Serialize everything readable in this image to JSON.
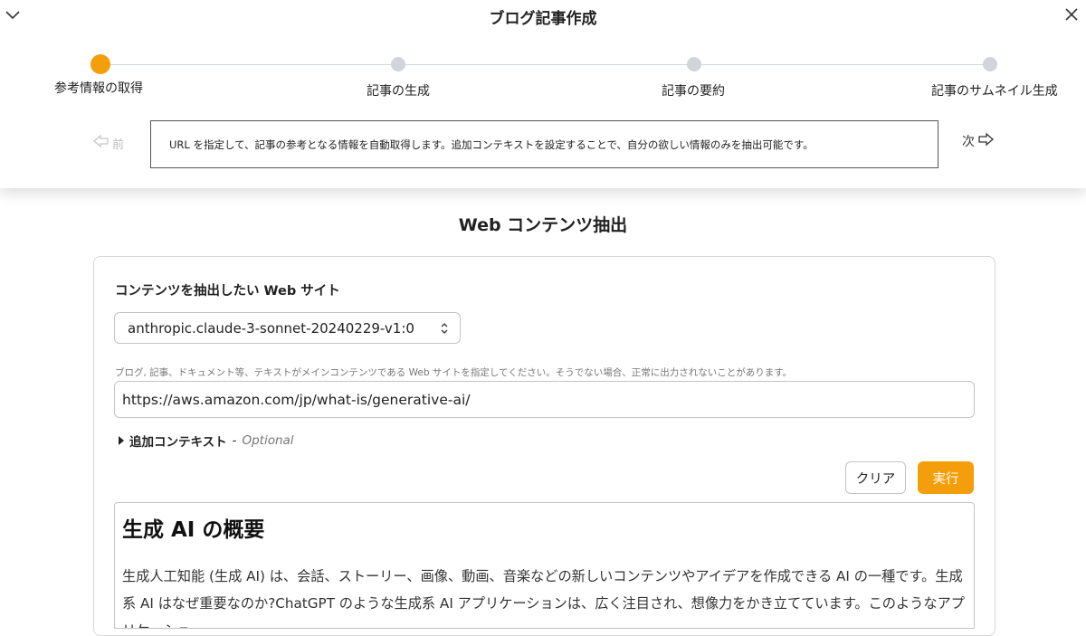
{
  "header": {
    "title": "ブログ記事作成",
    "collapse_icon": "chevron-down-icon",
    "close_icon": "close-icon"
  },
  "stepper": {
    "active_index": 0,
    "active_color": "#f59e0b",
    "inactive_color": "#d1d5db",
    "steps": [
      {
        "label": "参考情報の取得"
      },
      {
        "label": "記事の生成"
      },
      {
        "label": "記事の要約"
      },
      {
        "label": "記事のサムネイル生成"
      }
    ],
    "prev_label": "前",
    "next_label": "次",
    "description": "URL を指定して、記事の参考となる情報を自動取得します。追加コンテキストを設定することで、自分の欲しい情報のみを抽出可能です。"
  },
  "main": {
    "section_title": "Web コンテンツ抽出",
    "field_label": "コンテンツを抽出したい Web サイト",
    "model_select": "anthropic.claude-3-sonnet-20240229-v1:0",
    "hint": "ブログ, 記事、ドキュメント等、テキストがメインコンテンツである Web サイトを指定してください。そうでない場合、正常に出力されないことがあります。",
    "url_value": "https://aws.amazon.com/jp/what-is/generative-ai/",
    "extra_context_label": "追加コンテキスト",
    "extra_context_sep": "-",
    "extra_context_optional": "Optional",
    "clear_label": "クリア",
    "run_label": "実行",
    "accent_color": "#f59e0b"
  },
  "result": {
    "heading": "生成 AI の概要",
    "body": "生成人工知能 (生成 AI) は、会話、ストーリー、画像、動画、音楽などの新しいコンテンツやアイデアを作成できる AI の一種です。生成系 AI はなぜ重要なのか?ChatGPT のような生成系 AI アプリケーションは、広く注目され、想像力をかき立てています。このようなアプリケーショ"
  }
}
